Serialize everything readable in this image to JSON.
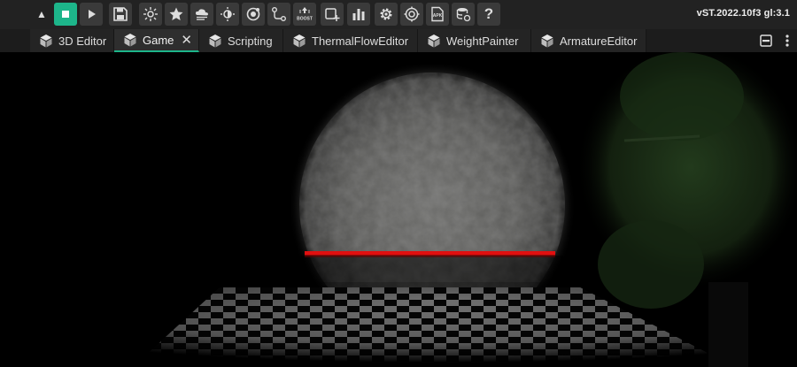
{
  "toolbar": {
    "version": "vST.2022.10f3 gl:3.1",
    "buttons": [
      {
        "icon": "collapse-up-icon",
        "glyph": "▲"
      },
      {
        "icon": "stop-icon",
        "state": "active"
      },
      {
        "icon": "play-icon"
      },
      {
        "icon": "save-icon"
      },
      {
        "icon": "sun-light-icon"
      },
      {
        "icon": "star-icon"
      },
      {
        "icon": "cloud-settings-icon"
      },
      {
        "icon": "brightness-icon"
      },
      {
        "icon": "orbit-icon"
      },
      {
        "icon": "node-path-icon"
      },
      {
        "icon": "boost-icon",
        "label": "BOOST"
      },
      {
        "icon": "add-window-icon"
      },
      {
        "icon": "bar-chart-icon"
      },
      {
        "icon": "settings-gear-icon"
      },
      {
        "icon": "target-settings-icon"
      },
      {
        "icon": "apk-export-icon",
        "label": "APK"
      },
      {
        "icon": "database-sync-icon"
      },
      {
        "icon": "help-icon",
        "glyph": "?"
      }
    ]
  },
  "tabs": [
    {
      "label": "3D Editor",
      "active": false
    },
    {
      "label": "Game",
      "active": true,
      "closable": true
    },
    {
      "label": "Scripting",
      "active": false
    },
    {
      "label": "ThermalFlowEditor",
      "active": false
    },
    {
      "label": "WeightPainter",
      "active": false
    },
    {
      "label": "ArmatureEditor",
      "active": false
    }
  ],
  "colors": {
    "accent": "#1db58a",
    "toolbar_bg": "#222222",
    "button_bg": "#3a3a3a",
    "laser_red": "#e01010"
  }
}
